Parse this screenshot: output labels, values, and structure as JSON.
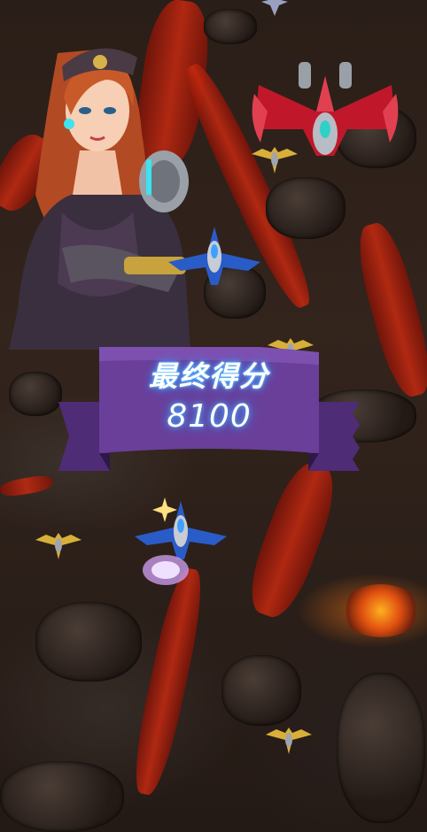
{
  "game": {
    "final_score_label": "最终得分",
    "final_score_value": "8100"
  },
  "colors": {
    "banner_purple": "#6a3f9a",
    "score_glow": "#4fb8ff",
    "lava": "#c72a10"
  },
  "sprites": {
    "boss": "red-boss-ship-icon",
    "player": "blue-player-ship-icon",
    "enemy": "yellow-enemy-ship-icon",
    "burst": "explosion-icon"
  }
}
